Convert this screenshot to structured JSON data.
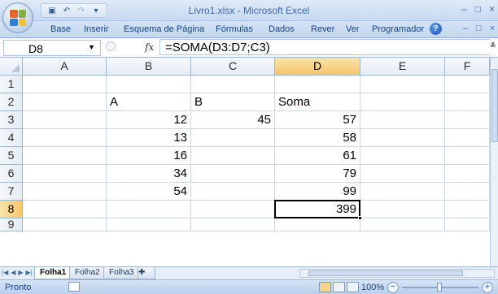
{
  "window": {
    "title": "Livro1.xlsx - Microsoft Excel",
    "controls": [
      "–",
      "□",
      "×"
    ]
  },
  "quick_access": {
    "icons": [
      "save-icon",
      "undo-icon",
      "redo-icon",
      "customize-icon"
    ]
  },
  "ribbon": {
    "tabs": [
      "Base",
      "Inserir",
      "Esquema de Página",
      "Fórmulas",
      "Dados",
      "Rever",
      "Ver",
      "Programador"
    ],
    "help_label": "?",
    "sub_controls": [
      "–",
      "□",
      "×"
    ]
  },
  "formula_bar": {
    "name_box": "D8",
    "fx_label": "fx",
    "formula": "=SOMA(D3:D7;C3)"
  },
  "grid": {
    "columns": [
      "A",
      "B",
      "C",
      "D",
      "E",
      "F"
    ],
    "selected_column": "D",
    "rows": [
      "1",
      "2",
      "3",
      "4",
      "5",
      "6",
      "7",
      "8",
      "9"
    ],
    "selected_row": "8",
    "cells": {
      "B2": "A",
      "C2": "B",
      "D2": "Soma",
      "B3": "12",
      "C3": "45",
      "D3": "57",
      "B4": "13",
      "D4": "58",
      "B5": "16",
      "D5": "61",
      "B6": "34",
      "D6": "79",
      "B7": "54",
      "D7": "99",
      "D8": "399"
    },
    "active_cell": "D8"
  },
  "sheets": {
    "tabs": [
      "Folha1",
      "Folha2",
      "Folha3"
    ],
    "active": "Folha1"
  },
  "status": {
    "mode": "Pronto",
    "zoom": "100%"
  }
}
